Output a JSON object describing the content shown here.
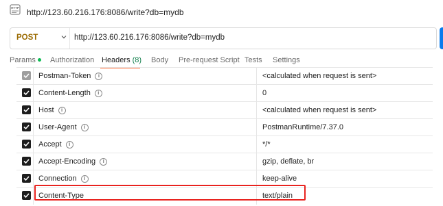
{
  "titlebar": {
    "icon": "http-icon",
    "url": "http://123.60.216.176:8086/write?db=mydb"
  },
  "request": {
    "method": "POST",
    "url": "http://123.60.216.176:8086/write?db=mydb"
  },
  "tabs": [
    {
      "label": "Params",
      "dot": true
    },
    {
      "label": "Authorization"
    },
    {
      "label": "Headers",
      "count": "(8)",
      "active": true
    },
    {
      "label": "Body"
    },
    {
      "label": "Pre-request Script"
    },
    {
      "label": "Tests"
    },
    {
      "label": "Settings"
    }
  ],
  "headers": [
    {
      "checked": true,
      "disabled": true,
      "key": "Postman-Token",
      "value": "<calculated when request is sent>"
    },
    {
      "checked": true,
      "key": "Content-Length",
      "value": "0"
    },
    {
      "checked": true,
      "key": "Host",
      "value": "<calculated when request is sent>"
    },
    {
      "checked": true,
      "key": "User-Agent",
      "value": "PostmanRuntime/7.37.0"
    },
    {
      "checked": true,
      "key": "Accept",
      "value": "*/*"
    },
    {
      "checked": true,
      "key": "Accept-Encoding",
      "value": "gzip, deflate, br"
    },
    {
      "checked": true,
      "key": "Connection",
      "value": "keep-alive"
    },
    {
      "checked": true,
      "key": "Content-Type",
      "value": "text/plain",
      "info": false
    }
  ],
  "colors": {
    "method": "#9a6a00",
    "active_tab_underline": "#ff6c37",
    "highlight": "#e8231f",
    "send": "#097bed"
  }
}
